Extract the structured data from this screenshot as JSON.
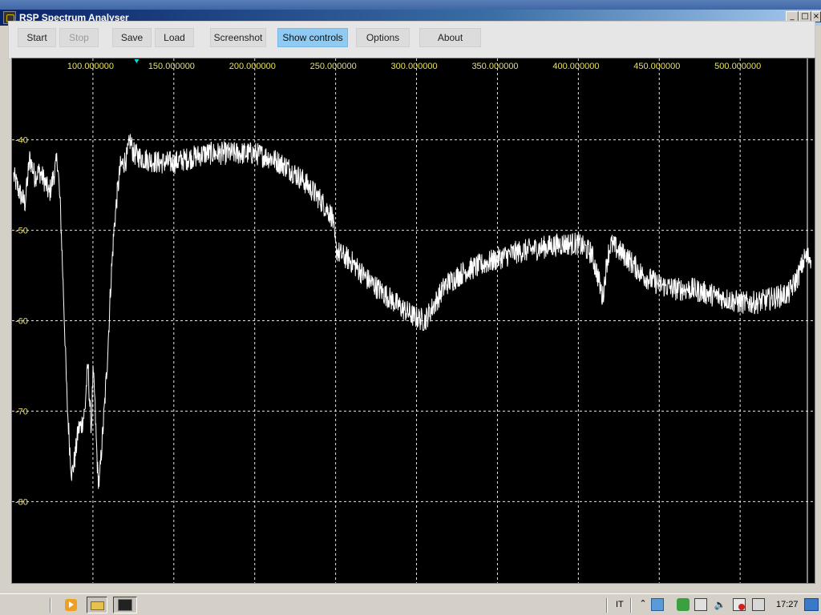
{
  "window": {
    "title": "RSP Spectrum Analyser",
    "controls": {
      "minimize": "_",
      "maximize": "□",
      "close": "×"
    }
  },
  "toolbar": {
    "buttons": [
      {
        "id": "start",
        "label": "Start",
        "state": "normal"
      },
      {
        "id": "stop",
        "label": "Stop",
        "state": "disabled"
      },
      {
        "id": "save",
        "label": "Save",
        "state": "normal"
      },
      {
        "id": "load",
        "label": "Load",
        "state": "normal"
      },
      {
        "id": "screenshot",
        "label": "Screenshot",
        "state": "normal"
      },
      {
        "id": "show_controls",
        "label": "Show controls",
        "state": "active"
      },
      {
        "id": "options",
        "label": "Options",
        "state": "normal"
      },
      {
        "id": "about",
        "label": "About",
        "state": "normal"
      }
    ]
  },
  "spectrum": {
    "background_color": "#000000",
    "grid_color": "#ffffff",
    "trace_color": "#ffffff",
    "label_color": "#e8e060",
    "marker_color": "#00e0e0",
    "x_ticks": [
      "100.000000",
      "150.000000",
      "200.000000",
      "250.000000",
      "300.000000",
      "350.000000",
      "400.000000",
      "450.000000",
      "500.000000"
    ],
    "x_tick_values": [
      100,
      150,
      200,
      250,
      300,
      350,
      400,
      450,
      500
    ],
    "y_ticks": [
      "-40",
      "-50",
      "-60",
      "-70",
      "-80"
    ],
    "y_tick_values": [
      -40,
      -50,
      -60,
      -70,
      -80
    ],
    "x_range": [
      50,
      546
    ],
    "y_range": [
      -31,
      -89
    ],
    "marker_x": 127,
    "trace_keypoints": [
      [
        51,
        -44
      ],
      [
        55,
        -46
      ],
      [
        58,
        -47
      ],
      [
        61,
        -42
      ],
      [
        64,
        -44
      ],
      [
        67,
        -43.5
      ],
      [
        70,
        -44.5
      ],
      [
        73,
        -46
      ],
      [
        75,
        -44.5
      ],
      [
        77,
        -43
      ],
      [
        78,
        -42
      ],
      [
        80,
        -48
      ],
      [
        82,
        -58
      ],
      [
        84,
        -69
      ],
      [
        86,
        -75
      ],
      [
        87,
        -77
      ],
      [
        89,
        -75
      ],
      [
        91,
        -72
      ],
      [
        93,
        -71.5
      ],
      [
        95,
        -70
      ],
      [
        96,
        -67
      ],
      [
        97,
        -65
      ],
      [
        98,
        -69
      ],
      [
        99,
        -72
      ],
      [
        100,
        -66
      ],
      [
        101,
        -68
      ],
      [
        102,
        -73
      ],
      [
        103,
        -77
      ],
      [
        104,
        -78
      ],
      [
        105,
        -75
      ],
      [
        107,
        -70
      ],
      [
        109,
        -64
      ],
      [
        111,
        -56
      ],
      [
        113,
        -50
      ],
      [
        115,
        -46
      ],
      [
        117,
        -43
      ],
      [
        119,
        -42.5
      ],
      [
        121,
        -42
      ],
      [
        123,
        -40
      ],
      [
        125,
        -41.5
      ],
      [
        130,
        -42
      ],
      [
        140,
        -42.5
      ],
      [
        150,
        -42.5
      ],
      [
        160,
        -42
      ],
      [
        170,
        -41.5
      ],
      [
        180,
        -41.5
      ],
      [
        190,
        -41.5
      ],
      [
        200,
        -41.5
      ],
      [
        210,
        -42
      ],
      [
        220,
        -43
      ],
      [
        230,
        -44.5
      ],
      [
        240,
        -46.5
      ],
      [
        248,
        -48.5
      ],
      [
        250,
        -52
      ],
      [
        252,
        -52.5
      ],
      [
        260,
        -53.5
      ],
      [
        270,
        -55.5
      ],
      [
        280,
        -57
      ],
      [
        290,
        -58.5
      ],
      [
        298,
        -59.5
      ],
      [
        305,
        -60
      ],
      [
        310,
        -58.5
      ],
      [
        318,
        -56
      ],
      [
        330,
        -54.5
      ],
      [
        345,
        -53.5
      ],
      [
        360,
        -52.5
      ],
      [
        375,
        -52
      ],
      [
        390,
        -51.5
      ],
      [
        400,
        -51.5
      ],
      [
        408,
        -52.5
      ],
      [
        412,
        -55
      ],
      [
        415,
        -57.5
      ],
      [
        418,
        -53
      ],
      [
        420,
        -51.5
      ],
      [
        430,
        -53
      ],
      [
        440,
        -55
      ],
      [
        450,
        -56
      ],
      [
        460,
        -56.5
      ],
      [
        470,
        -56.5
      ],
      [
        480,
        -57
      ],
      [
        490,
        -57.5
      ],
      [
        500,
        -58
      ],
      [
        510,
        -58
      ],
      [
        520,
        -57.5
      ],
      [
        530,
        -57
      ],
      [
        536,
        -55
      ],
      [
        540,
        -53
      ],
      [
        544,
        -53
      ]
    ]
  },
  "taskbar": {
    "language": "IT",
    "clock": "17:27"
  }
}
